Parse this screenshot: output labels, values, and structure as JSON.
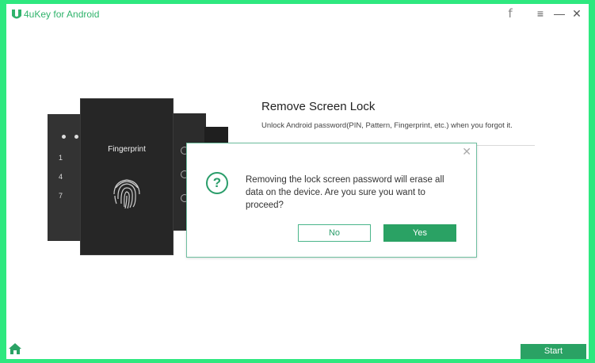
{
  "app": {
    "title": "4uKey for Android",
    "accent": "#2aa264",
    "border_color": "#2ee87f"
  },
  "titlebar": {
    "facebook_icon": "f",
    "menu_icon": "≡",
    "minimize_icon": "—",
    "close_icon": "✕"
  },
  "phone": {
    "fingerprint_label": "Fingerprint",
    "keypad": [
      "1",
      "4",
      "7"
    ]
  },
  "main": {
    "title": "Remove Screen Lock",
    "description": "Unlock Android password(PIN, Pattern, Fingerprint, etc.) when you forgot it."
  },
  "dialog": {
    "icon": "?",
    "message": "Removing the lock screen password will erase all data on the device. Are you sure you want to proceed?",
    "no_label": "No",
    "yes_label": "Yes",
    "close_icon": "✕"
  },
  "bottom": {
    "start_label": "Start",
    "home_icon": "home-icon"
  }
}
